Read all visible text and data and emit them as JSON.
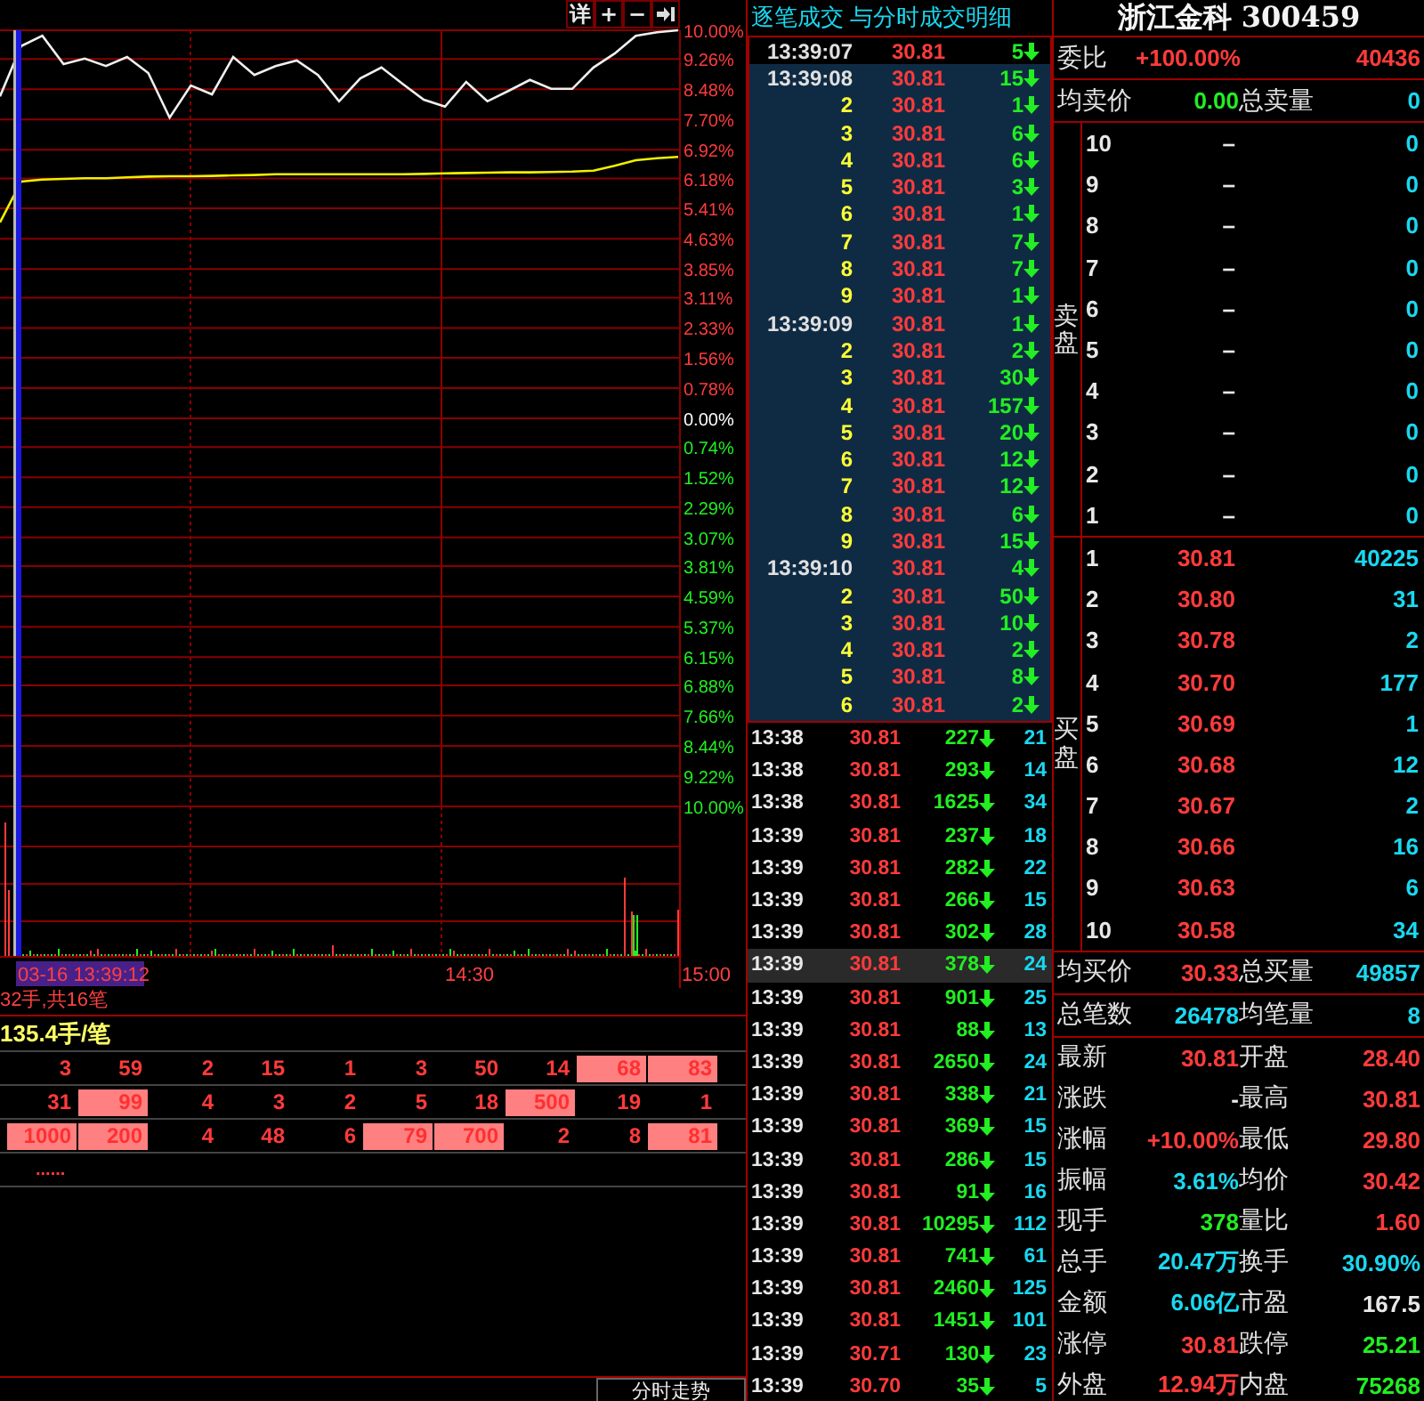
{
  "chart": {
    "tools": [
      {
        "kind": "text",
        "label": "详"
      },
      {
        "kind": "text",
        "label": "+"
      },
      {
        "kind": "text",
        "label": "−"
      },
      {
        "kind": "icon"
      }
    ],
    "time_axis": [
      {
        "label": "03-16 13:39:12",
        "kind": "cursor"
      },
      {
        "label": "14:30",
        "kind": "tick"
      },
      {
        "label": "15:00",
        "kind": "tick"
      }
    ],
    "chart_data": {
      "type": "line",
      "ylim": [
        -10,
        10
      ],
      "grid": true,
      "yticks": [
        {
          "value": 10,
          "label": "10.00%"
        },
        {
          "value": 9.26,
          "label": "9.26%"
        },
        {
          "value": 8.48,
          "label": "8.48%"
        },
        {
          "value": 7.7,
          "label": "7.70%"
        },
        {
          "value": 6.92,
          "label": "6.92%"
        },
        {
          "value": 6.18,
          "label": "6.18%"
        },
        {
          "value": 5.41,
          "label": "5.41%"
        },
        {
          "value": 4.63,
          "label": "4.63%"
        },
        {
          "value": 3.85,
          "label": "3.85%"
        },
        {
          "value": 3.11,
          "label": "3.11%"
        },
        {
          "value": 2.33,
          "label": "2.33%"
        },
        {
          "value": 1.56,
          "label": "1.56%"
        },
        {
          "value": 0.78,
          "label": "0.78%"
        },
        {
          "value": 0,
          "label": "0.00%"
        },
        {
          "value": -0.74,
          "label": "0.74%"
        },
        {
          "value": -1.52,
          "label": "1.52%"
        },
        {
          "value": -2.29,
          "label": "2.29%"
        },
        {
          "value": -3.07,
          "label": "3.07%"
        },
        {
          "value": -3.81,
          "label": "3.81%"
        },
        {
          "value": -4.59,
          "label": "4.59%"
        },
        {
          "value": -5.37,
          "label": "5.37%"
        },
        {
          "value": -6.15,
          "label": "6.15%"
        },
        {
          "value": -6.88,
          "label": "6.88%"
        },
        {
          "value": -7.66,
          "label": "7.66%"
        },
        {
          "value": -8.44,
          "label": "8.44%"
        },
        {
          "value": -9.22,
          "label": "9.22%"
        },
        {
          "value": -10,
          "label": "10.00%"
        }
      ],
      "series": [
        {
          "color": "#f0f0f0",
          "values": [
            8.3,
            9.59,
            9.86,
            9.13,
            9.27,
            9.08,
            9.31,
            8.9,
            7.75,
            8.58,
            8.35,
            9.31,
            8.85,
            9.08,
            9.22,
            8.85,
            8.17,
            8.76,
            9.04,
            8.62,
            8.21,
            8.03,
            8.67,
            8.17,
            8.44,
            8.72,
            8.49,
            8.49,
            9.04,
            9.4,
            9.86,
            9.95,
            10.0
          ]
        },
        {
          "color": "#f0f000",
          "values": [
            5.05,
            6.1,
            6.15,
            6.17,
            6.19,
            6.19,
            6.21,
            6.23,
            6.24,
            6.24,
            6.25,
            6.26,
            6.27,
            6.29,
            6.29,
            6.29,
            6.29,
            6.29,
            6.29,
            6.29,
            6.3,
            6.31,
            6.32,
            6.33,
            6.34,
            6.34,
            6.35,
            6.36,
            6.38,
            6.51,
            6.65,
            6.7,
            6.74
          ]
        }
      ]
    }
  },
  "info_line": "32手,共16笔",
  "avg_line": "135.4手/笔",
  "order_rows": [
    {
      "cells": [
        {
          "v": "3",
          "hl": false
        },
        {
          "v": "59",
          "hl": false
        },
        {
          "v": "2",
          "hl": false
        },
        {
          "v": "15",
          "hl": false
        },
        {
          "v": "1",
          "hl": false
        },
        {
          "v": "3",
          "hl": false
        },
        {
          "v": "50",
          "hl": false
        },
        {
          "v": "14",
          "hl": false
        },
        {
          "v": "68",
          "hl": true
        },
        {
          "v": "83",
          "hl": true
        }
      ]
    },
    {
      "cells": [
        {
          "v": "31",
          "hl": false
        },
        {
          "v": "99",
          "hl": true
        },
        {
          "v": "4",
          "hl": false
        },
        {
          "v": "3",
          "hl": false
        },
        {
          "v": "2",
          "hl": false
        },
        {
          "v": "5",
          "hl": false
        },
        {
          "v": "18",
          "hl": false
        },
        {
          "v": "500",
          "hl": true
        },
        {
          "v": "19",
          "hl": false
        },
        {
          "v": "1",
          "hl": false
        }
      ]
    },
    {
      "cells": [
        {
          "v": "1000",
          "hl": true
        },
        {
          "v": "200",
          "hl": true
        },
        {
          "v": "4",
          "hl": false
        },
        {
          "v": "48",
          "hl": false
        },
        {
          "v": "6",
          "hl": false
        },
        {
          "v": "79",
          "hl": true
        },
        {
          "v": "700",
          "hl": true
        },
        {
          "v": "2",
          "hl": false
        },
        {
          "v": "8",
          "hl": false
        },
        {
          "v": "81",
          "hl": true
        }
      ]
    }
  ],
  "more": "......",
  "bottom_tabs": [
    {
      "label": "分时走势"
    }
  ],
  "ticks": {
    "title": "逐笔成交 与分时成交明细",
    "rows": [
      {
        "time": "13:39:07",
        "price": "30.81",
        "vol": "5",
        "down": true,
        "selected": true
      },
      {
        "time": "13:39:08",
        "price": "30.81",
        "vol": "15",
        "down": true,
        "selected": false
      },
      {
        "seq": "2",
        "price": "30.81",
        "vol": "1",
        "down": true,
        "selected": false
      },
      {
        "seq": "3",
        "price": "30.81",
        "vol": "6",
        "down": true,
        "selected": false
      },
      {
        "seq": "4",
        "price": "30.81",
        "vol": "6",
        "down": true,
        "selected": false
      },
      {
        "seq": "5",
        "price": "30.81",
        "vol": "3",
        "down": true,
        "selected": false
      },
      {
        "seq": "6",
        "price": "30.81",
        "vol": "1",
        "down": true,
        "selected": false
      },
      {
        "seq": "7",
        "price": "30.81",
        "vol": "7",
        "down": true,
        "selected": false
      },
      {
        "seq": "8",
        "price": "30.81",
        "vol": "7",
        "down": true,
        "selected": false
      },
      {
        "seq": "9",
        "price": "30.81",
        "vol": "1",
        "down": true,
        "selected": false
      },
      {
        "time": "13:39:09",
        "price": "30.81",
        "vol": "1",
        "down": true,
        "selected": false
      },
      {
        "seq": "2",
        "price": "30.81",
        "vol": "2",
        "down": true,
        "selected": false
      },
      {
        "seq": "3",
        "price": "30.81",
        "vol": "30",
        "down": true,
        "selected": false
      },
      {
        "seq": "4",
        "price": "30.81",
        "vol": "157",
        "down": true,
        "selected": false
      },
      {
        "seq": "5",
        "price": "30.81",
        "vol": "20",
        "down": true,
        "selected": false
      },
      {
        "seq": "6",
        "price": "30.81",
        "vol": "12",
        "down": true,
        "selected": false
      },
      {
        "seq": "7",
        "price": "30.81",
        "vol": "12",
        "down": true,
        "selected": false
      },
      {
        "seq": "8",
        "price": "30.81",
        "vol": "6",
        "down": true,
        "selected": false
      },
      {
        "seq": "9",
        "price": "30.81",
        "vol": "15",
        "down": true,
        "selected": false
      },
      {
        "time": "13:39:10",
        "price": "30.81",
        "vol": "4",
        "down": true,
        "selected": false
      },
      {
        "seq": "2",
        "price": "30.81",
        "vol": "50",
        "down": true,
        "selected": false
      },
      {
        "seq": "3",
        "price": "30.81",
        "vol": "10",
        "down": true,
        "selected": false
      },
      {
        "seq": "4",
        "price": "30.81",
        "vol": "2",
        "down": true,
        "selected": false
      },
      {
        "seq": "5",
        "price": "30.81",
        "vol": "8",
        "down": true,
        "selected": false
      },
      {
        "seq": "6",
        "price": "30.81",
        "vol": "2",
        "down": true,
        "selected": false
      }
    ]
  },
  "minutes": [
    {
      "time": "13:38",
      "price": "30.81",
      "vol": "227",
      "down": true,
      "count": "21",
      "selected": false
    },
    {
      "time": "13:38",
      "price": "30.81",
      "vol": "293",
      "down": true,
      "count": "14",
      "selected": false
    },
    {
      "time": "13:38",
      "price": "30.81",
      "vol": "1625",
      "down": true,
      "count": "34",
      "selected": false
    },
    {
      "time": "13:39",
      "price": "30.81",
      "vol": "237",
      "down": true,
      "count": "18",
      "selected": false
    },
    {
      "time": "13:39",
      "price": "30.81",
      "vol": "282",
      "down": true,
      "count": "22",
      "selected": false
    },
    {
      "time": "13:39",
      "price": "30.81",
      "vol": "266",
      "down": true,
      "count": "15",
      "selected": false
    },
    {
      "time": "13:39",
      "price": "30.81",
      "vol": "302",
      "down": true,
      "count": "28",
      "selected": false
    },
    {
      "time": "13:39",
      "price": "30.81",
      "vol": "378",
      "down": true,
      "count": "24",
      "selected": true
    },
    {
      "time": "13:39",
      "price": "30.81",
      "vol": "901",
      "down": true,
      "count": "25",
      "selected": false
    },
    {
      "time": "13:39",
      "price": "30.81",
      "vol": "88",
      "down": true,
      "count": "13",
      "selected": false
    },
    {
      "time": "13:39",
      "price": "30.81",
      "vol": "2650",
      "down": true,
      "count": "24",
      "selected": false
    },
    {
      "time": "13:39",
      "price": "30.81",
      "vol": "338",
      "down": true,
      "count": "21",
      "selected": false
    },
    {
      "time": "13:39",
      "price": "30.81",
      "vol": "369",
      "down": true,
      "count": "15",
      "selected": false
    },
    {
      "time": "13:39",
      "price": "30.81",
      "vol": "286",
      "down": true,
      "count": "15",
      "selected": false
    },
    {
      "time": "13:39",
      "price": "30.81",
      "vol": "91",
      "down": true,
      "count": "16",
      "selected": false
    },
    {
      "time": "13:39",
      "price": "30.81",
      "vol": "10295",
      "down": true,
      "count": "112",
      "selected": false
    },
    {
      "time": "13:39",
      "price": "30.81",
      "vol": "741",
      "down": true,
      "count": "61",
      "selected": false
    },
    {
      "time": "13:39",
      "price": "30.81",
      "vol": "2460",
      "down": true,
      "count": "125",
      "selected": false
    },
    {
      "time": "13:39",
      "price": "30.81",
      "vol": "1451",
      "down": true,
      "count": "101",
      "selected": false
    },
    {
      "time": "13:39",
      "price": "30.71",
      "vol": "130",
      "down": true,
      "count": "23",
      "selected": false
    },
    {
      "time": "13:39",
      "price": "30.70",
      "vol": "35",
      "down": true,
      "count": "5",
      "selected": false
    }
  ],
  "quote": {
    "title": "浙江金科 300459",
    "ratio": {
      "fields": [
        {
          "label": "委比",
          "value": "+100.00%",
          "color": "#ff3b3b"
        },
        {
          "value": "40436",
          "color": "#ff3b3b"
        }
      ]
    },
    "sell_summary": {
      "fields": [
        {
          "label": "均卖价",
          "value": "0.00",
          "color": "#22ee22"
        },
        {
          "label": "总卖量",
          "value": "0",
          "color": "#19d8f0"
        }
      ]
    },
    "sell": {
      "label": "卖盘",
      "levels": [
        {
          "level": "10",
          "price": "–",
          "color": "#e8e8e8",
          "vol": "0"
        },
        {
          "level": "9",
          "price": "–",
          "color": "#e8e8e8",
          "vol": "0"
        },
        {
          "level": "8",
          "price": "–",
          "color": "#e8e8e8",
          "vol": "0"
        },
        {
          "level": "7",
          "price": "–",
          "color": "#e8e8e8",
          "vol": "0"
        },
        {
          "level": "6",
          "price": "–",
          "color": "#e8e8e8",
          "vol": "0"
        },
        {
          "level": "5",
          "price": "–",
          "color": "#e8e8e8",
          "vol": "0"
        },
        {
          "level": "4",
          "price": "–",
          "color": "#e8e8e8",
          "vol": "0"
        },
        {
          "level": "3",
          "price": "–",
          "color": "#e8e8e8",
          "vol": "0"
        },
        {
          "level": "2",
          "price": "–",
          "color": "#e8e8e8",
          "vol": "0"
        },
        {
          "level": "1",
          "price": "–",
          "color": "#e8e8e8",
          "vol": "0"
        }
      ]
    },
    "buy": {
      "label": "买盘",
      "levels": [
        {
          "level": "1",
          "price": "30.81",
          "color": "#ff3b3b",
          "vol": "40225"
        },
        {
          "level": "2",
          "price": "30.80",
          "color": "#ff3b3b",
          "vol": "31"
        },
        {
          "level": "3",
          "price": "30.78",
          "color": "#ff3b3b",
          "vol": "2"
        },
        {
          "level": "4",
          "price": "30.70",
          "color": "#ff3b3b",
          "vol": "177"
        },
        {
          "level": "5",
          "price": "30.69",
          "color": "#ff3b3b",
          "vol": "1"
        },
        {
          "level": "6",
          "price": "30.68",
          "color": "#ff3b3b",
          "vol": "12"
        },
        {
          "level": "7",
          "price": "30.67",
          "color": "#ff3b3b",
          "vol": "2"
        },
        {
          "level": "8",
          "price": "30.66",
          "color": "#ff3b3b",
          "vol": "16"
        },
        {
          "level": "9",
          "price": "30.63",
          "color": "#ff3b3b",
          "vol": "6"
        },
        {
          "level": "10",
          "price": "30.58",
          "color": "#ff3b3b",
          "vol": "34"
        }
      ]
    },
    "buy_summary": {
      "fields": [
        {
          "label": "均买价",
          "value": "30.33",
          "color": "#ff3b3b"
        },
        {
          "label": "总买量",
          "value": "49857",
          "color": "#19d8f0"
        }
      ]
    },
    "count_summary": {
      "fields": [
        {
          "label": "总笔数",
          "value": "26478",
          "color": "#19d8f0"
        },
        {
          "label": "均笔量",
          "value": "8",
          "color": "#19d8f0"
        }
      ]
    },
    "stats": [
      {
        "fields": [
          {
            "label": "最新",
            "value": "30.81",
            "color": "#ff3b3b"
          },
          {
            "label": "开盘",
            "value": "28.40",
            "color": "#ff3b3b"
          }
        ]
      },
      {
        "fields": [
          {
            "label": "涨跌",
            "value": "-",
            "color": "#e8e8e8"
          },
          {
            "label": "最高",
            "value": "30.81",
            "color": "#ff3b3b"
          }
        ]
      },
      {
        "fields": [
          {
            "label": "涨幅",
            "value": "+10.00%",
            "color": "#ff3b3b"
          },
          {
            "label": "最低",
            "value": "29.80",
            "color": "#ff3b3b"
          }
        ]
      },
      {
        "fields": [
          {
            "label": "振幅",
            "value": "3.61%",
            "color": "#19d8f0"
          },
          {
            "label": "均价",
            "value": "30.42",
            "color": "#ff3b3b"
          }
        ]
      },
      {
        "fields": [
          {
            "label": "现手",
            "value": "378",
            "color": "#22ee22"
          },
          {
            "label": "量比",
            "value": "1.60",
            "color": "#ff3b3b"
          }
        ]
      },
      {
        "fields": [
          {
            "label": "总手",
            "value": "20.47万",
            "color": "#19d8f0"
          },
          {
            "label": "换手",
            "value": "30.90%",
            "color": "#19d8f0"
          }
        ]
      },
      {
        "fields": [
          {
            "label": "金额",
            "value": "6.06亿",
            "color": "#19d8f0"
          },
          {
            "label": "市盈",
            "value": "167.5",
            "color": "#e8e8e8"
          }
        ]
      },
      {
        "fields": [
          {
            "label": "涨停",
            "value": "30.81",
            "color": "#ff3b3b"
          },
          {
            "label": "跌停",
            "value": "25.21",
            "color": "#22ee22"
          }
        ]
      },
      {
        "fields": [
          {
            "label": "外盘",
            "value": "12.94万",
            "color": "#ff3b3b"
          },
          {
            "label": "内盘",
            "value": "75268",
            "color": "#22ee22"
          }
        ]
      }
    ]
  }
}
